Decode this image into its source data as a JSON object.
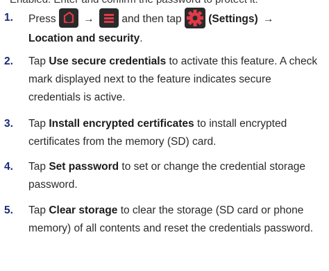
{
  "intro": "Enabled. Enter and confirm the password to protect it.",
  "accent_color": "#1a2a78",
  "icon_bg": "#2a2a2a",
  "icon_red": "#e03a47",
  "steps": [
    {
      "num": "1.",
      "press": "Press",
      "arrow": "→",
      "then_tap": "and then tap",
      "settings": "(Settings)",
      "target": "Location and security",
      "end": ".",
      "icons": [
        "home-icon",
        "menu-icon",
        "settings-gear-icon"
      ]
    },
    {
      "num": "2.",
      "pre": "Tap",
      "bold": "Use secure credentials",
      "post": "to activate this feature. A check mark displayed next to the feature indicates secure credentials is active."
    },
    {
      "num": "3.",
      "pre": "Tap",
      "bold": "Install encrypted certificates",
      "post": "to install encrypted certificates from the memory (SD) card."
    },
    {
      "num": "4.",
      "pre": "Tap",
      "bold": "Set password",
      "post": "to set or change the credential storage password."
    },
    {
      "num": "5.",
      "pre": "Tap",
      "bold": "Clear storage",
      "post": "to clear the storage (SD card or phone memory) of all contents and reset the credentials password."
    }
  ]
}
